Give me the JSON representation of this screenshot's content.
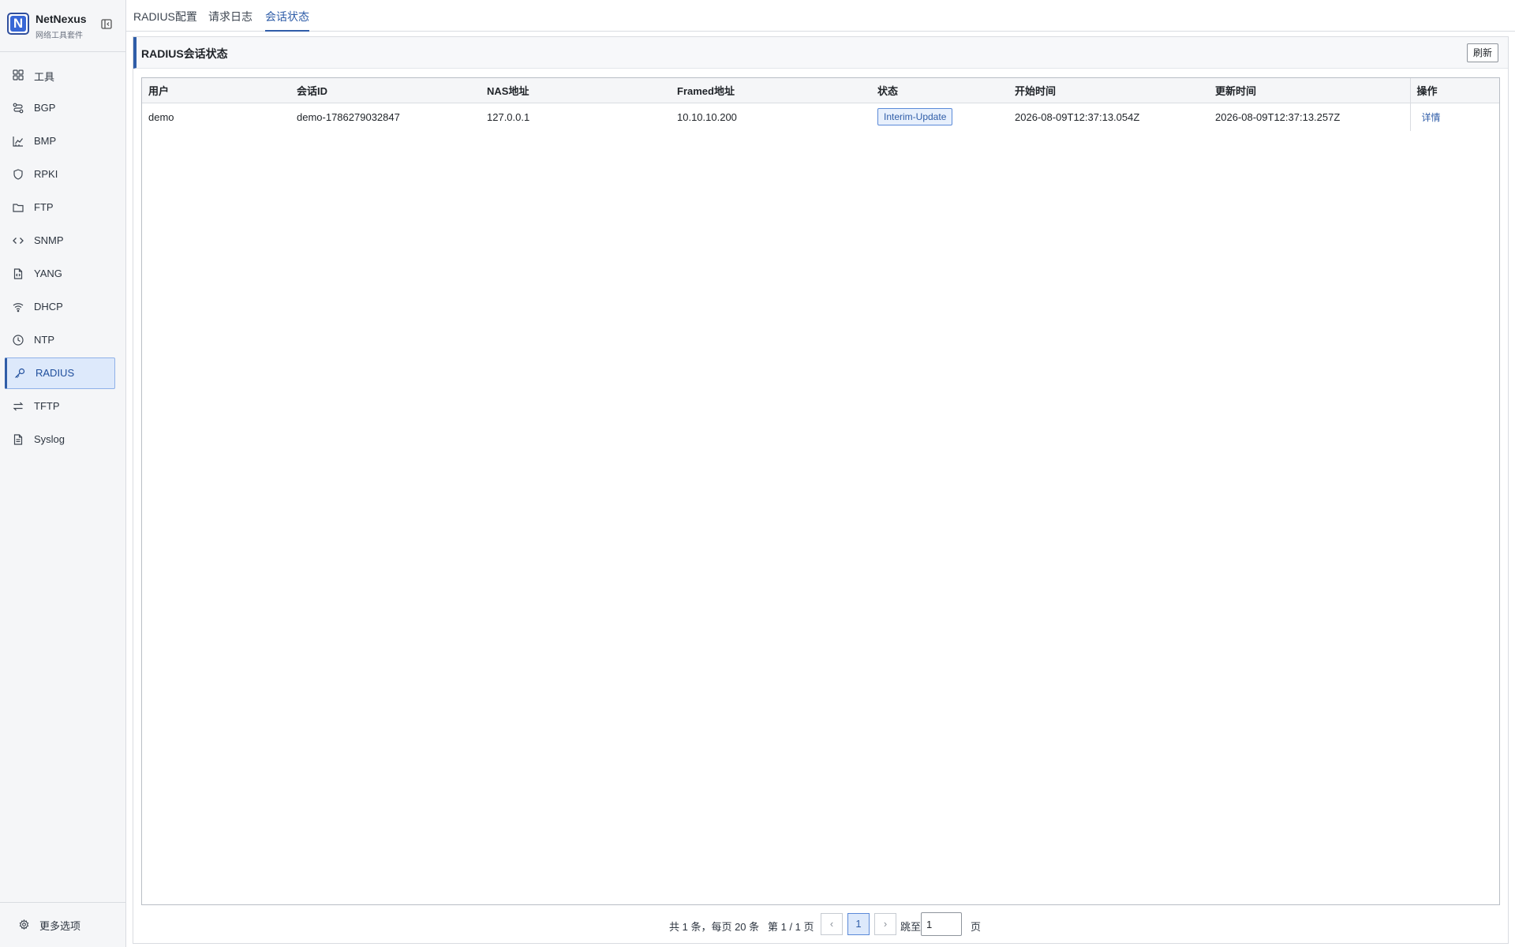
{
  "brand": {
    "name": "NetNexus",
    "subtitle": "网络工具套件",
    "logo_letter": "N"
  },
  "sidebar": {
    "items": [
      {
        "label": "工具",
        "icon": "grid-icon"
      },
      {
        "label": "BGP",
        "icon": "route-icon"
      },
      {
        "label": "BMP",
        "icon": "chart-icon"
      },
      {
        "label": "RPKI",
        "icon": "shield-icon"
      },
      {
        "label": "FTP",
        "icon": "folder-icon"
      },
      {
        "label": "SNMP",
        "icon": "code-icon"
      },
      {
        "label": "YANG",
        "icon": "file-code-icon"
      },
      {
        "label": "DHCP",
        "icon": "wifi-icon"
      },
      {
        "label": "NTP",
        "icon": "clock-icon"
      },
      {
        "label": "RADIUS",
        "icon": "key-icon",
        "active": true
      },
      {
        "label": "TFTP",
        "icon": "transfer-icon"
      },
      {
        "label": "Syslog",
        "icon": "document-icon"
      }
    ],
    "footer_label": "更多选项"
  },
  "tabs": [
    {
      "label": "RADIUS配置"
    },
    {
      "label": "请求日志"
    },
    {
      "label": "会话状态",
      "active": true
    }
  ],
  "panel": {
    "title": "RADIUS会话状态",
    "refresh_label": "刷新"
  },
  "table": {
    "columns": [
      "用户",
      "会话ID",
      "NAS地址",
      "Framed地址",
      "状态",
      "开始时间",
      "更新时间",
      "操作"
    ],
    "rows": [
      {
        "user": "demo",
        "session_id": "demo-1786279032847",
        "nas": "127.0.0.1",
        "framed": "10.10.10.200",
        "status": "Interim-Update",
        "start": "2026-08-09T12:37:13.054Z",
        "updated": "2026-08-09T12:37:13.257Z",
        "action": "详情"
      }
    ]
  },
  "pagination": {
    "summary": "共 1 条，每页 20 条",
    "page_info": "第 1 / 1 页",
    "prev": "‹",
    "current": "1",
    "next": "›",
    "jump_label": "跳至",
    "jump_value": "1",
    "page_suffix": "页"
  },
  "colors": {
    "accent": "#2f5da8",
    "active_bg": "#dde9fb",
    "sidebar_bg": "#f5f6f8"
  }
}
